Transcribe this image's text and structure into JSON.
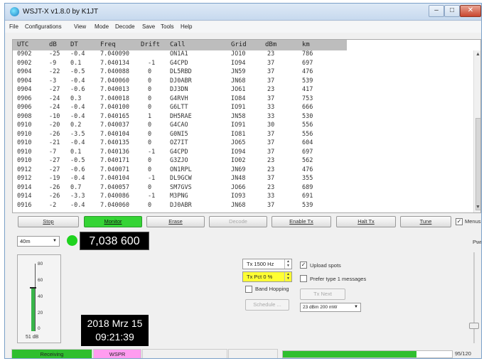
{
  "window": {
    "title": "WSJT-X   v1.8.0   by K1JT"
  },
  "menu": [
    "File",
    "Configurations",
    "View",
    "Mode",
    "Decode",
    "Save",
    "Tools",
    "Help"
  ],
  "table": {
    "headers": [
      "UTC",
      "dB",
      "DT",
      "Freq",
      "Drift",
      "Call",
      "Grid",
      "dBm",
      "km"
    ],
    "rows": [
      [
        "0902",
        "-25",
        "-0.4",
        "7.040090",
        "",
        "ON1A1",
        "JO10",
        "23",
        "786"
      ],
      [
        "0902",
        "-9",
        "0.1",
        "7.040134",
        "-1",
        "G4CPD",
        "IO94",
        "37",
        "697"
      ],
      [
        "0904",
        "-22",
        "-0.5",
        "7.040088",
        "0",
        "DL5RBD",
        "JN59",
        "37",
        "476"
      ],
      [
        "0904",
        "-3",
        "-0.4",
        "7.040060",
        "0",
        "DJ0ABR",
        "JN68",
        "37",
        "539"
      ],
      [
        "0904",
        "-27",
        "-0.6",
        "7.040013",
        "0",
        "DJ3DN",
        "JO61",
        "23",
        "417"
      ],
      [
        "0906",
        "-24",
        "0.3",
        "7.040018",
        "0",
        "G4RVH",
        "IO84",
        "37",
        "753"
      ],
      [
        "0906",
        "-24",
        "-0.4",
        "7.040100",
        "0",
        "G6LTT",
        "IO91",
        "33",
        "666"
      ],
      [
        "0908",
        "-10",
        "-0.4",
        "7.040165",
        "1",
        "DH5RAE",
        "JN58",
        "33",
        "530"
      ],
      [
        "0910",
        "-20",
        "0.2",
        "7.040037",
        "0",
        "G4CAO",
        "IO91",
        "30",
        "556"
      ],
      [
        "0910",
        "-26",
        "-3.5",
        "7.040104",
        "0",
        "G0NI5",
        "IO81",
        "37",
        "556"
      ],
      [
        "0910",
        "-21",
        "-0.4",
        "7.040135",
        "0",
        "OZ7IT",
        "JO65",
        "37",
        "604"
      ],
      [
        "0910",
        "-7",
        "0.1",
        "7.040136",
        "-1",
        "G4CPD",
        "IO94",
        "37",
        "697"
      ],
      [
        "0910",
        "-27",
        "-0.5",
        "7.040171",
        "0",
        "G3ZJO",
        "IO02",
        "23",
        "562"
      ],
      [
        "0912",
        "-27",
        "-0.6",
        "7.040071",
        "0",
        "ON1RPL",
        "JN69",
        "23",
        "476"
      ],
      [
        "0912",
        "-19",
        "-0.4",
        "7.040104",
        "-1",
        "DL9GCW",
        "JN48",
        "37",
        "355"
      ],
      [
        "0914",
        "-26",
        "0.7",
        "7.040057",
        "0",
        "SM7GVS",
        "JO66",
        "23",
        "689"
      ],
      [
        "0914",
        "-26",
        "-3.3",
        "7.040086",
        "-1",
        "M3PNG",
        "IO93",
        "33",
        "691"
      ],
      [
        "0916",
        "-2",
        "-0.4",
        "7.040060",
        "0",
        "DJ0ABR",
        "JN68",
        "37",
        "539"
      ]
    ]
  },
  "buttons": {
    "stop": "Stop",
    "monitor": "Monitor",
    "erase": "Erase",
    "decode": "Decode",
    "enable_tx": "Enable Tx",
    "halt_tx": "Halt Tx",
    "tune": "Tune",
    "menus": "Menus"
  },
  "band": {
    "selected": "40m"
  },
  "dial_frequency": "7,038 600",
  "pwr_label": "Pwr",
  "meter": {
    "ticks": [
      "80",
      "60",
      "40",
      "20",
      "0"
    ],
    "level_db": 51,
    "reading": "51 dB"
  },
  "datetime": {
    "date": "2018 Mrz 15",
    "time": "09:21:39"
  },
  "controls": {
    "tx_freq": "Tx  1500  Hz",
    "tx_pct": "Tx Pct 0  %",
    "band_hopping": "Band Hopping",
    "schedule": "Schedule ...",
    "upload_spots": "Upload spots",
    "prefer_type1": "Prefer type 1 messages",
    "tx_next": "Tx Next",
    "power": "23 dBm  200 mW"
  },
  "status": {
    "state": "Receiving",
    "mode": "WSPR",
    "progress": "95/120",
    "progress_fraction": 0.79,
    "colors": {
      "receiving": "#2fbf2f",
      "mode": "#ff9cf0"
    }
  }
}
